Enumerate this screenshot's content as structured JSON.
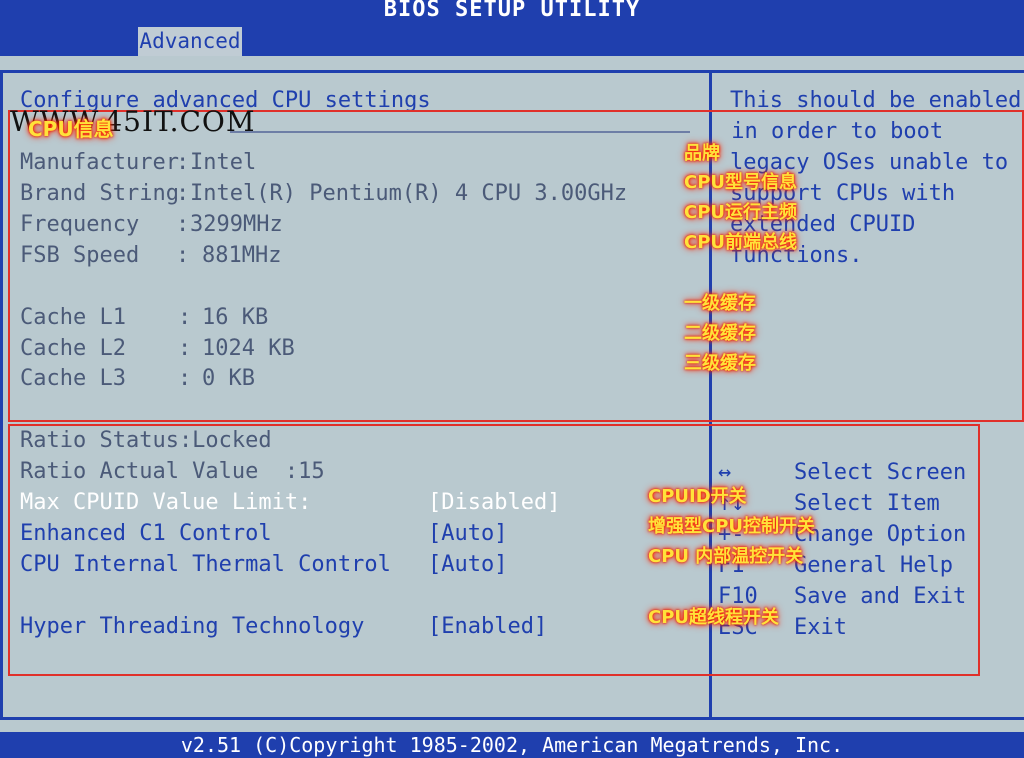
{
  "window": {
    "title": "BIOS SETUP UTILITY"
  },
  "menu": {
    "active_tab": "Advanced"
  },
  "panel": {
    "heading": "Configure advanced CPU settings",
    "heading_overlay": "CPU信息",
    "info": [
      {
        "label": "Manufacturer",
        "sep": ":",
        "value": "Intel"
      },
      {
        "label": "Brand String",
        "sep": ":",
        "value": "Intel(R) Pentium(R) 4 CPU 3.00GHz"
      },
      {
        "label": "Frequency",
        "sep": ":",
        "value": "3299MHz"
      },
      {
        "label": "FSB Speed",
        "sep": ":",
        "value": "881MHz"
      }
    ],
    "cache": [
      {
        "label": "Cache L1",
        "value": "16 KB"
      },
      {
        "label": "Cache L2",
        "value": "1024 KB"
      },
      {
        "label": "Cache L3",
        "value": "0 KB"
      }
    ],
    "ratio_status": "Ratio Status:Locked",
    "ratio_actual": "Ratio Actual Value  :15",
    "settings": [
      {
        "label": "Max CPUID Value Limit:",
        "value": "[Disabled]"
      },
      {
        "label": "Enhanced C1 Control",
        "value": "[Auto]"
      },
      {
        "label": "CPU Internal Thermal Control",
        "value": "[Auto]"
      },
      {
        "label": "Hyper Threading Technology",
        "value": "[Enabled]"
      }
    ]
  },
  "help": {
    "lines": [
      "This should be enabled",
      " in order to boot",
      "legacy OSes unable to",
      "support CPUs with",
      "extended CPUID",
      "functions."
    ]
  },
  "keys": [
    {
      "key": "↔",
      "action": "Select Screen"
    },
    {
      "key": "↑↓",
      "action": "Select Item"
    },
    {
      "key": "+-",
      "action": "Change Option"
    },
    {
      "key": "F1",
      "action": "General Help"
    },
    {
      "key": "F10",
      "action": "Save and Exit"
    },
    {
      "key": "ESC",
      "action": "Exit"
    }
  ],
  "annotations": {
    "brand": "品牌",
    "model": "CPU型号信息",
    "freq": "CPU运行主频",
    "fsb": "CPU前端总线",
    "l1": "一级缓存",
    "l2": "二级缓存",
    "l3": "三级缓存",
    "cpuid": "CPUID开关",
    "c1": "增强型CPU控制开关",
    "thermal": "CPU 内部温控开关",
    "ht": "CPU超线程开关"
  },
  "watermark": "WWW.45IT.COM",
  "status_bar": "v2.51 (C)Copyright 1985-2002, American Megatrends, Inc.",
  "colors": {
    "bios_blue": "#1f3fae",
    "panel_gray": "#b9c9cf",
    "annotation_red": "#e0302a",
    "annotation_yellow": "#ffe23a"
  }
}
